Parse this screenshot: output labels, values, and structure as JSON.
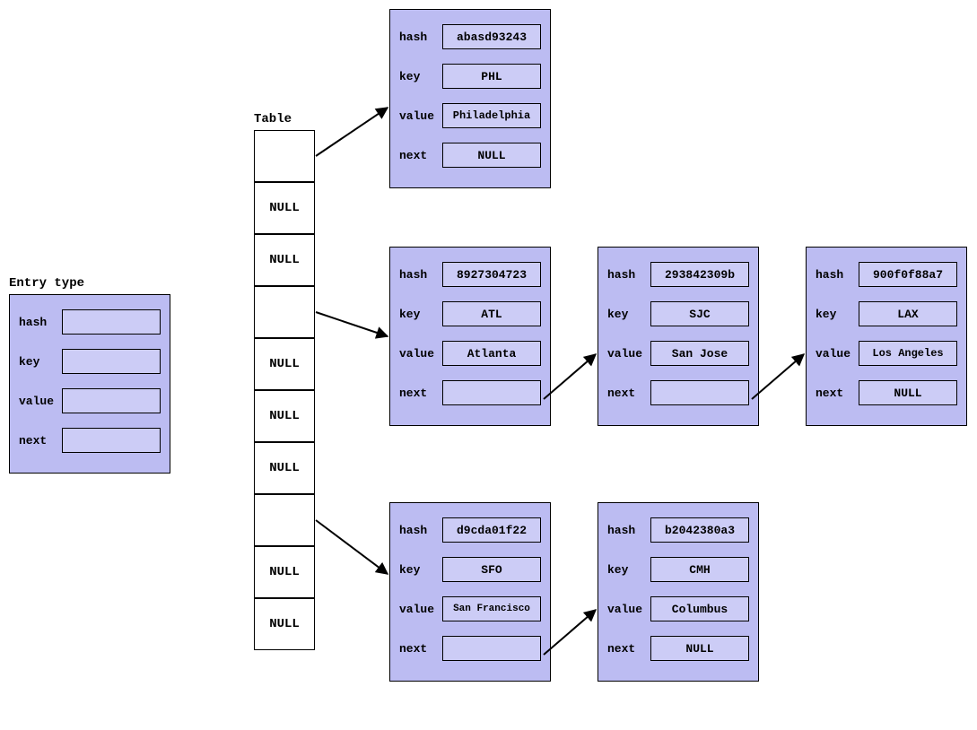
{
  "labels": {
    "entry_type": "Entry type",
    "table": "Table",
    "hash": "hash",
    "key": "key",
    "value": "value",
    "next": "next",
    "null": "NULL"
  },
  "table_slots": [
    "",
    "NULL",
    "NULL",
    "",
    "NULL",
    "NULL",
    "NULL",
    "",
    "NULL",
    "NULL"
  ],
  "nodes": {
    "phl": {
      "hash": "abasd93243",
      "key": "PHL",
      "value": "Philadelphia",
      "next": "NULL"
    },
    "atl": {
      "hash": "8927304723",
      "key": "ATL",
      "value": "Atlanta",
      "next": ""
    },
    "sjc": {
      "hash": "293842309b",
      "key": "SJC",
      "value": "San Jose",
      "next": ""
    },
    "lax": {
      "hash": "900f0f88a7",
      "key": "LAX",
      "value": "Los Angeles",
      "next": "NULL"
    },
    "sfo": {
      "hash": "d9cda01f22",
      "key": "SFO",
      "value": "San Francisco",
      "next": ""
    },
    "cmh": {
      "hash": "b2042380a3",
      "key": "CMH",
      "value": "Columbus",
      "next": "NULL"
    }
  }
}
